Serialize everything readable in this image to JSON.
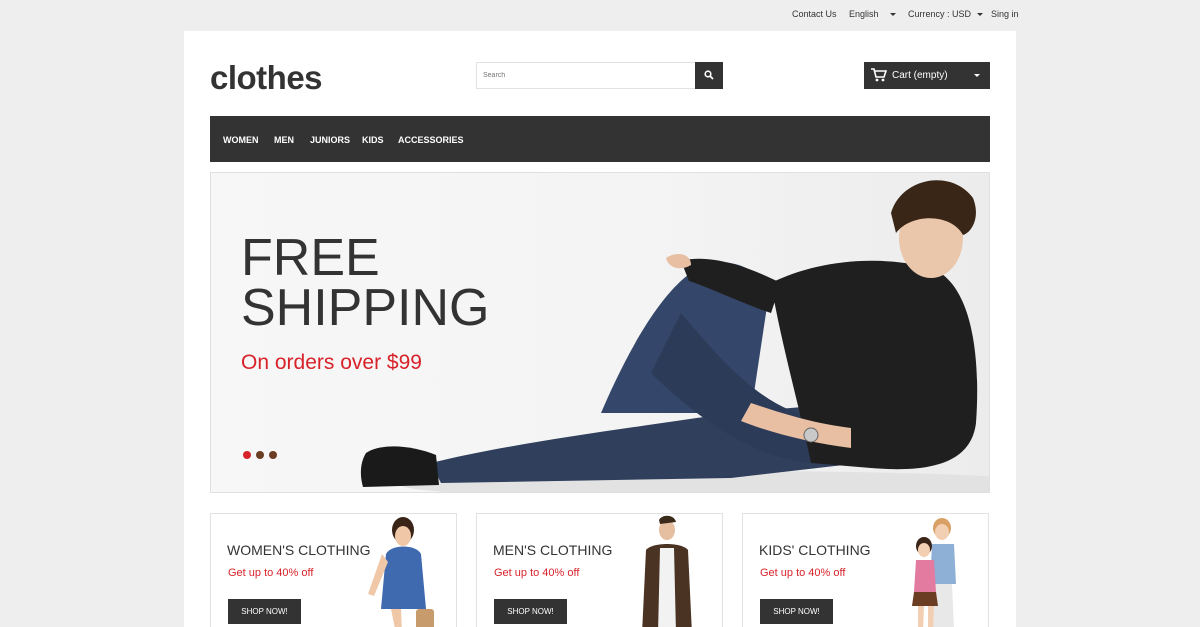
{
  "topbar": {
    "contact": "Contact Us",
    "language": "English",
    "currency": "Currency : USD",
    "signin": "Sing in"
  },
  "header": {
    "logo": "clothes",
    "search_placeholder": "Search",
    "cart_label": "Cart (empty)"
  },
  "nav": {
    "items": [
      "WOMEN",
      "MEN",
      "JUNIORS",
      "KIDS",
      "ACCESSORIES"
    ]
  },
  "banner": {
    "line1": "FREE",
    "line2": "SHIPPING",
    "sub": "On orders over $99",
    "dot_colors": [
      "#d8222a",
      "#6b3d22",
      "#6b3d22"
    ]
  },
  "promos": [
    {
      "title": "WOMEN'S CLOTHING",
      "note": "Get up to 40% off",
      "button": "SHOP NOW!"
    },
    {
      "title": "MEN'S CLOTHING",
      "note": "Get up to 40% off",
      "button": "SHOP NOW!"
    },
    {
      "title": "KIDS' CLOTHING",
      "note": "Get up to 40% off",
      "button": "SHOP NOW!"
    }
  ],
  "colors": {
    "accent": "#d8222a",
    "dark": "#333333"
  }
}
